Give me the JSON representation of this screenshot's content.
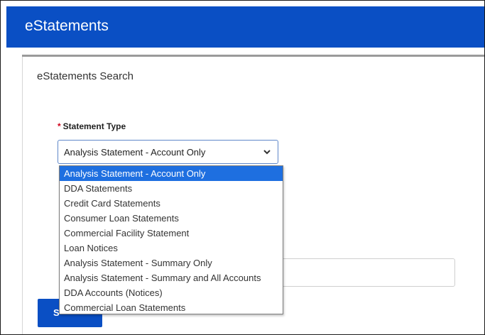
{
  "header": {
    "title": "eStatements"
  },
  "search": {
    "title": "eStatements Search"
  },
  "statement_type": {
    "required_mark": "*",
    "label": "Statement Type",
    "selected_value": "Analysis Statement - Account Only",
    "options": [
      "Analysis Statement - Account Only",
      "DDA Statements",
      "Credit Card Statements",
      "Consumer Loan Statements",
      "Commercial Facility Statement",
      "Loan Notices",
      "Analysis Statement - Summary Only",
      "Analysis Statement - Summary and All Accounts",
      "DDA Accounts (Notices)",
      "Commercial Loan Statements"
    ]
  },
  "submit": {
    "visible_label": "S"
  },
  "colors": {
    "brand": "#0a4fc4",
    "selected_option": "#1e6fe0",
    "required": "#d0021b"
  }
}
